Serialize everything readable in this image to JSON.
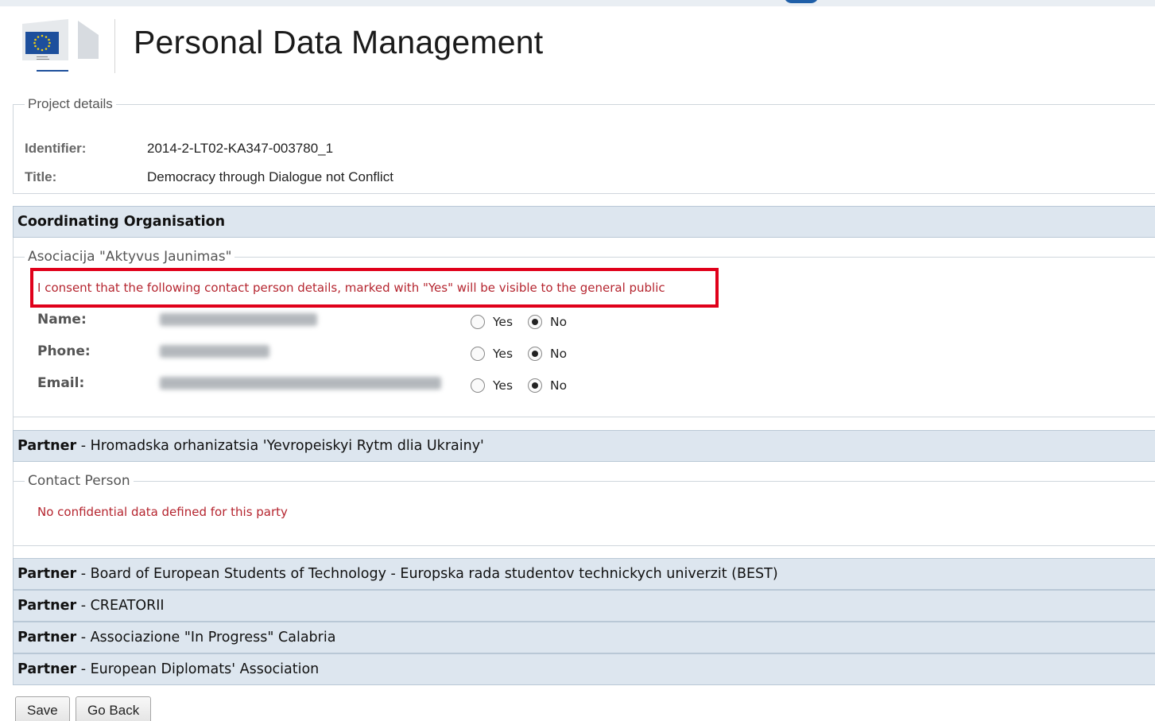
{
  "header": {
    "title": "Personal Data Management",
    "logo_alt": "European Commission"
  },
  "project": {
    "legend": "Project details",
    "identifier_label": "Identifier:",
    "identifier_value": "2014-2-LT02-KA347-003780_1",
    "title_label": "Title:",
    "title_value": "Democracy through Dialogue not Conflict"
  },
  "coordinating": {
    "heading": "Coordinating Organisation",
    "org_name": "Asociacija \"Aktyvus Jaunimas\"",
    "consent": "I consent that the following contact person details, marked with \"Yes\" will be visible to the general public",
    "fields": [
      {
        "label": "Name:",
        "yes": "Yes",
        "no": "No",
        "selected": "No"
      },
      {
        "label": "Phone:",
        "yes": "Yes",
        "no": "No",
        "selected": "No"
      },
      {
        "label": "Email:",
        "yes": "Yes",
        "no": "No",
        "selected": "No"
      }
    ]
  },
  "partner_prefix": "Partner",
  "partner_separator": " - ",
  "partners": [
    {
      "name": "Hromadska orhanizatsia 'Yevropeiskyi Rytm dlia Ukrainy'",
      "expanded": true,
      "contact_legend": "Contact Person",
      "message": "No confidential data defined for this party"
    },
    {
      "name": "Board of European Students of Technology - Europska rada studentov technickych univerzit (BEST)",
      "expanded": false
    },
    {
      "name": "CREATORII",
      "expanded": false
    },
    {
      "name": "Associazione \"In Progress\" Calabria",
      "expanded": false
    },
    {
      "name": "European Diplomats' Association",
      "expanded": false
    }
  ],
  "buttons": {
    "save": "Save",
    "go_back": "Go Back"
  },
  "colors": {
    "section_bg": "#dde6ef",
    "consent_highlight": "#e0001a",
    "notice_text": "#b5252f"
  }
}
